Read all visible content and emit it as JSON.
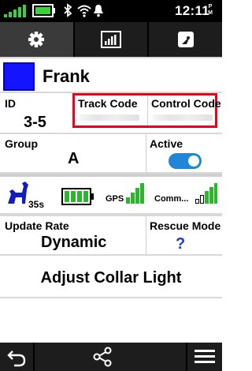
{
  "status_bar": {
    "time": "12:11",
    "ampm_top": "P",
    "ampm_bottom": "M"
  },
  "tabs": [
    {
      "icon": "gear-icon",
      "active": true
    },
    {
      "icon": "bar-chart-icon",
      "active": false
    },
    {
      "icon": "compass-map-icon",
      "active": false
    }
  ],
  "dog": {
    "name": "Frank",
    "color": "#1414ff"
  },
  "fields": {
    "id_label": "ID",
    "id_value": "3-5",
    "track_code_label": "Track Code",
    "control_code_label": "Control Code",
    "group_label": "Group",
    "group_value": "A",
    "active_label": "Active",
    "active_on": true
  },
  "status": {
    "dog_time": "35s",
    "gps_label": "GPS",
    "comm_label": "Comm..."
  },
  "settings": {
    "update_rate_label": "Update Rate",
    "update_rate_value": "Dynamic",
    "rescue_mode_label": "Rescue Mode",
    "rescue_mode_value": "?",
    "adjust_light_label": "Adjust Collar Light"
  },
  "colors": {
    "highlight_box": "#e8001c",
    "toggle": "#1f87d6",
    "battery": "#2db52d",
    "signal": "#2db52d"
  }
}
